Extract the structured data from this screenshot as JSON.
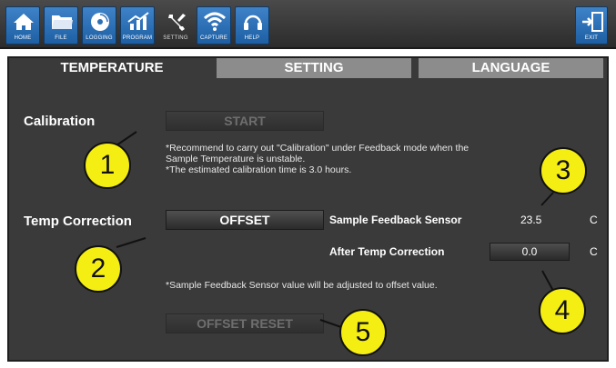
{
  "toolbar": {
    "buttons": [
      {
        "label": "HOME",
        "icon": "home-icon"
      },
      {
        "label": "FILE",
        "icon": "folder-icon"
      },
      {
        "label": "LOGGING",
        "icon": "disc-icon"
      },
      {
        "label": "PROGRAM",
        "icon": "chart-icon"
      },
      {
        "label": "SETTING",
        "icon": "wrench-icon"
      },
      {
        "label": "CAPTURE",
        "icon": "wifi-icon"
      },
      {
        "label": "HELP",
        "icon": "headset-icon"
      },
      {
        "label": "EXIT",
        "icon": "exit-icon"
      }
    ],
    "active": "SETTING"
  },
  "tabs": [
    {
      "label": "TEMPERATURE"
    },
    {
      "label": "SETTING"
    },
    {
      "label": "LANGUAGE"
    }
  ],
  "calibration": {
    "label": "Calibration",
    "button": "START",
    "note_1": "*Recommend to carry out \"Calibration\" under Feedback mode when the",
    "note_2": "Sample Temperature is unstable.",
    "note_3": "*The estimated calibration time is 3.0 hours."
  },
  "temp_correction": {
    "label": "Temp Correction",
    "button": "OFFSET",
    "sensor_label": "Sample Feedback Sensor",
    "sensor_value": "23.5",
    "sensor_unit": "C",
    "after_label": "After Temp Correction",
    "after_value": "0.0",
    "after_unit": "C",
    "note": "*Sample Feedback Sensor value will be adjusted to offset value.",
    "reset_button": "OFFSET RESET"
  },
  "callouts": [
    "1",
    "2",
    "3",
    "4",
    "5"
  ],
  "colors": {
    "toolbar_button": "#2f6fb5",
    "panel": "#3a3a3a",
    "inactive_tab": "#8c8c8c",
    "callout": "#f5ee12"
  }
}
